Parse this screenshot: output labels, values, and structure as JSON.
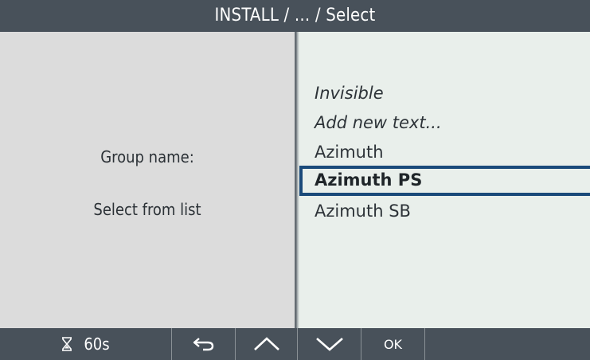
{
  "header": {
    "title": "INSTALL / ... / Select"
  },
  "left": {
    "group_name_label": "Group name:",
    "hint": "Select from list"
  },
  "list": {
    "items": [
      {
        "label": "Invisible",
        "style": "italic"
      },
      {
        "label": "Add new text...",
        "style": "italic"
      },
      {
        "label": "Azimuth",
        "style": "normal"
      },
      {
        "label": "Azimuth PS",
        "style": "selected"
      },
      {
        "label": "Azimuth SB",
        "style": "normal"
      }
    ],
    "selected_index": 3
  },
  "footer": {
    "timer": {
      "icon": "hourglass-icon",
      "value": "60s"
    },
    "back": {
      "icon": "back-arrow-icon"
    },
    "up": {
      "icon": "chevron-up-icon"
    },
    "down": {
      "icon": "chevron-down-icon"
    },
    "ok_label": "OK"
  },
  "colors": {
    "bar_background": "#48515a",
    "left_pane": "#dcdcdc",
    "right_pane": "#e9efeb",
    "selection_border": "#1a4a7a"
  }
}
